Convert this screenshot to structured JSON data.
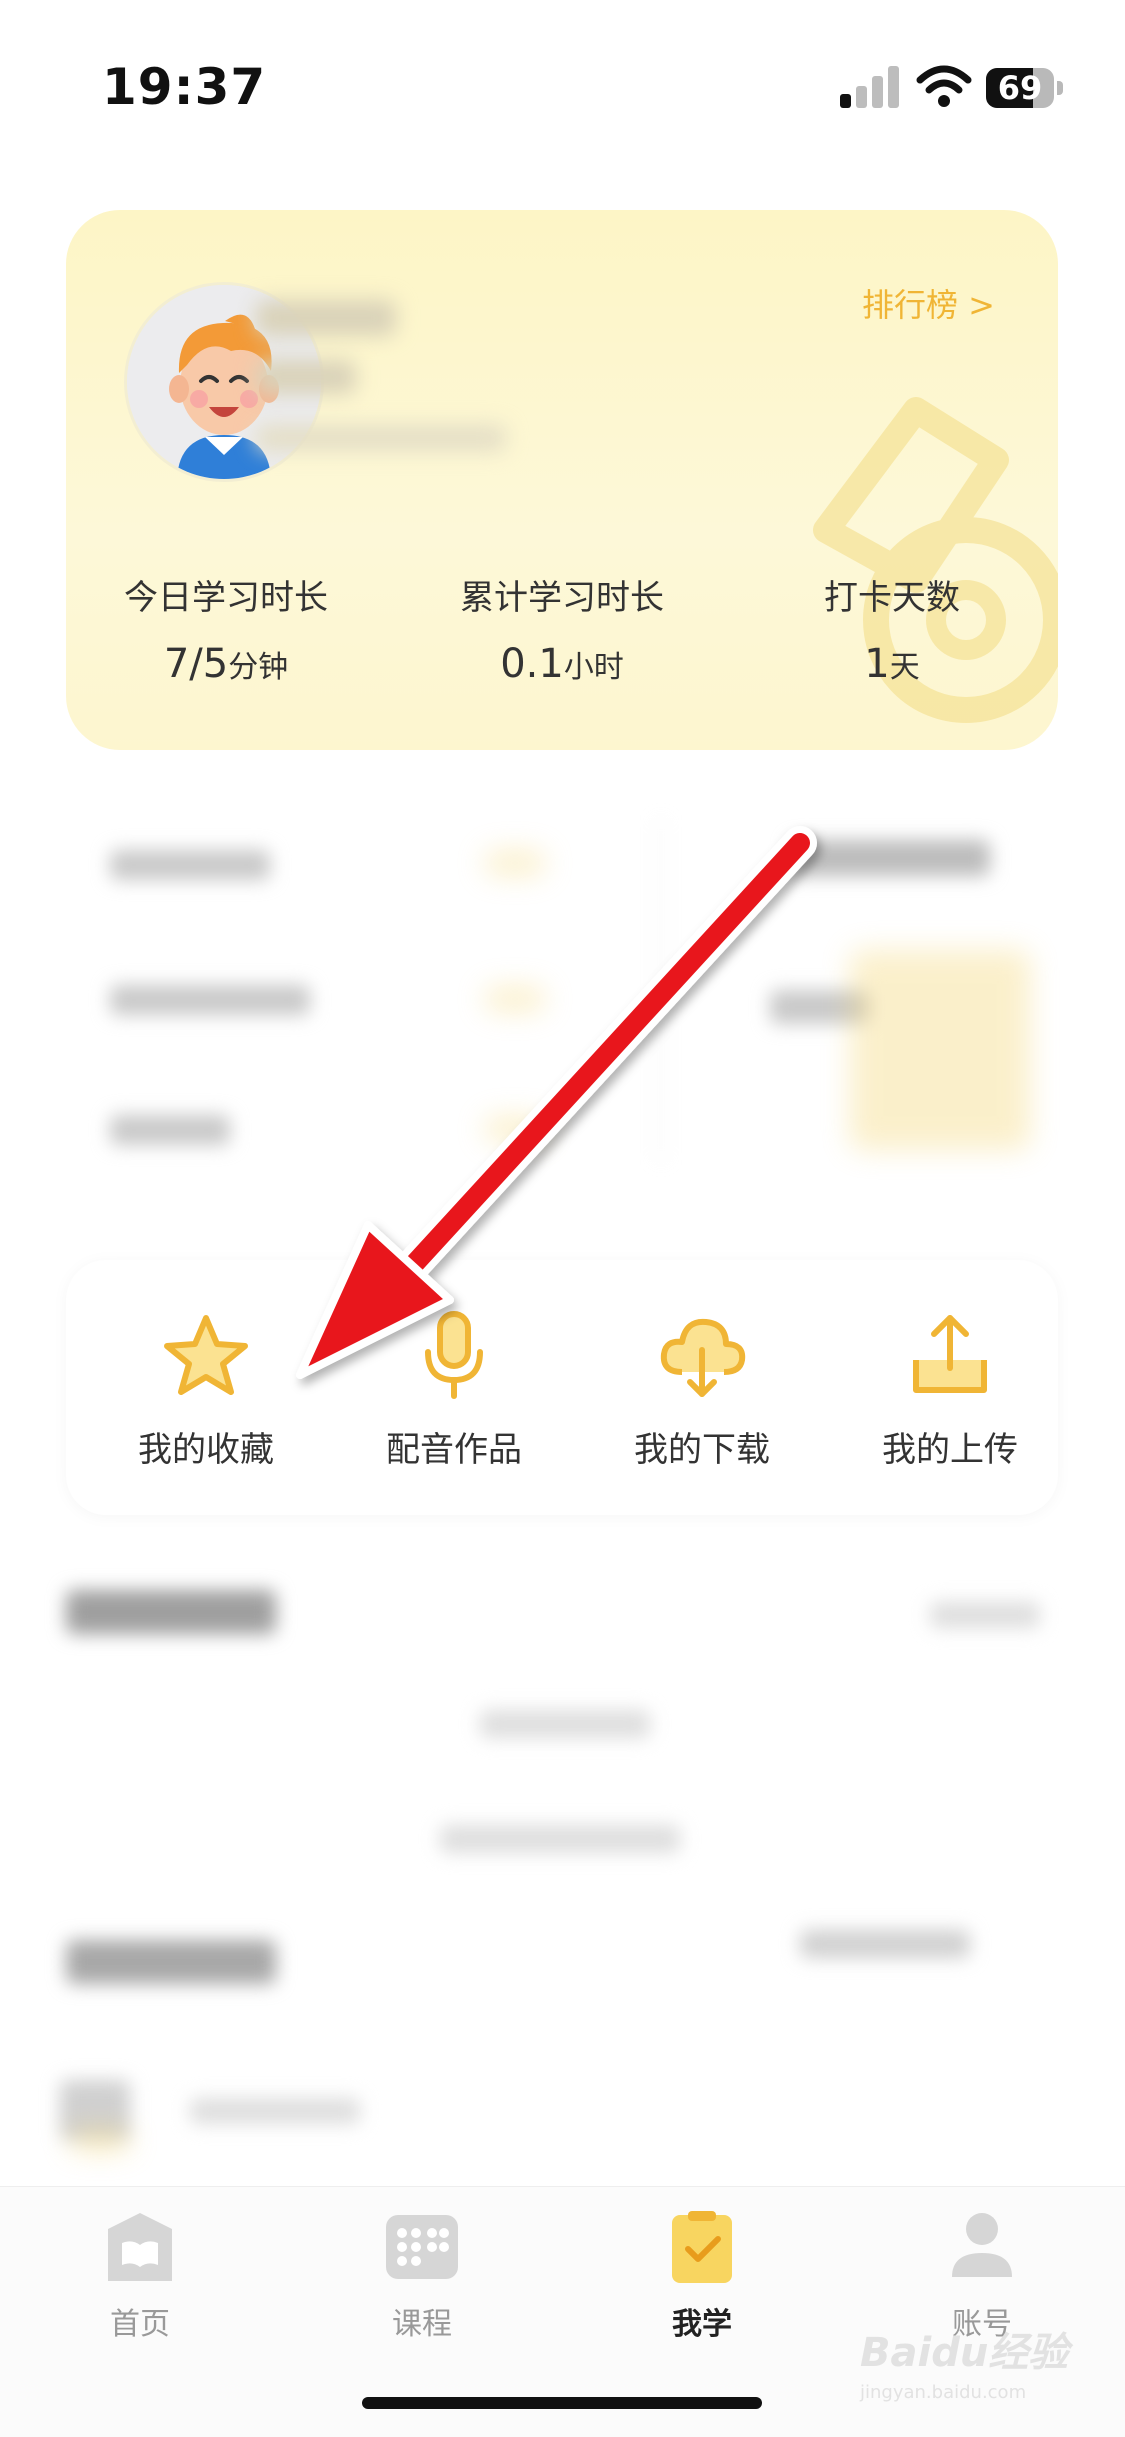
{
  "status_bar": {
    "time": "19:37",
    "battery_level": "69",
    "battery_fraction": 0.69,
    "icons": [
      "cellular-signal-icon",
      "wifi-icon",
      "battery-icon"
    ]
  },
  "profile": {
    "rank_link_label": "排行榜 >",
    "stats": [
      {
        "label": "今日学习时长",
        "value": "7/5",
        "unit": "分钟"
      },
      {
        "label": "累计学习时长",
        "value": "0.1",
        "unit": "小时"
      },
      {
        "label": "打卡天数",
        "value": "1",
        "unit": "天"
      }
    ]
  },
  "features": [
    {
      "label": "我的收藏",
      "icon": "star-icon"
    },
    {
      "label": "配音作品",
      "icon": "microphone-icon"
    },
    {
      "label": "我的下载",
      "icon": "cloud-download-icon"
    },
    {
      "label": "我的上传",
      "icon": "upload-icon"
    }
  ],
  "tabs": [
    {
      "label": "首页",
      "icon": "home-book-icon",
      "active": false
    },
    {
      "label": "课程",
      "icon": "course-grid-icon",
      "active": false
    },
    {
      "label": "我学",
      "icon": "clipboard-check-icon",
      "active": true
    },
    {
      "label": "账号",
      "icon": "account-person-icon",
      "active": false
    }
  ],
  "watermark": {
    "brand": "Baidu经验",
    "url": "jingyan.baidu.com"
  },
  "colors": {
    "accent": "#f0b535",
    "card_bg": "#fdf6cf",
    "annotation_arrow": "#e8141a"
  }
}
